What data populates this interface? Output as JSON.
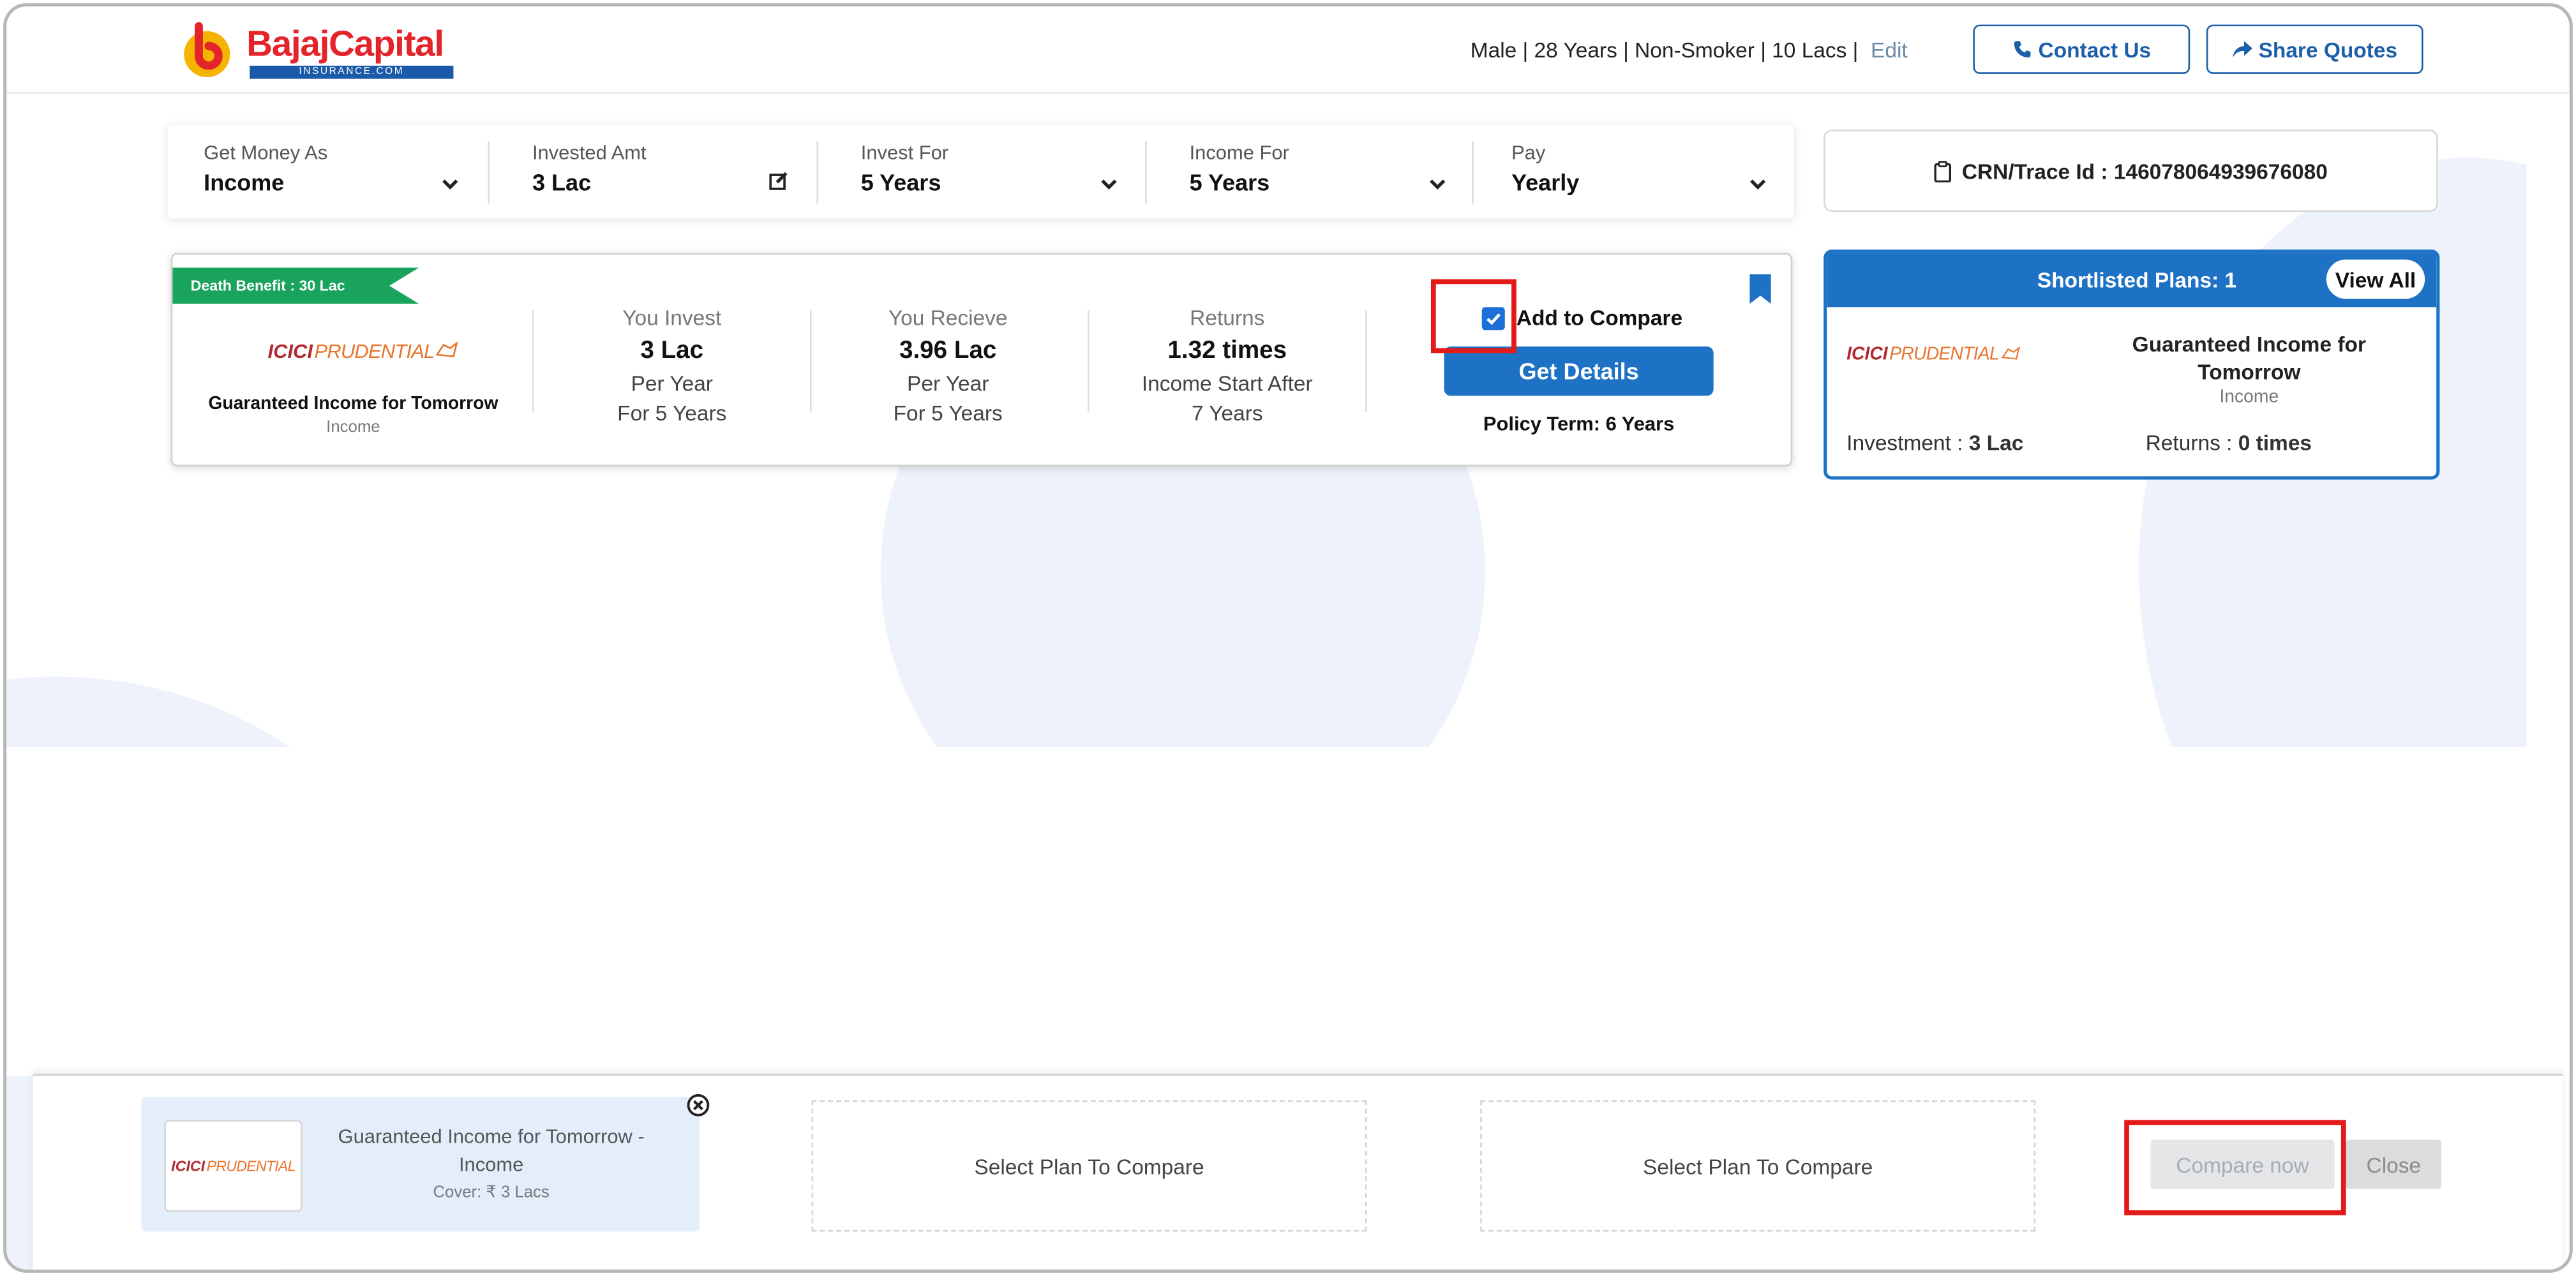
{
  "header": {
    "brand": "BajajCapital",
    "brand_sub": "INSURANCE.COM",
    "profile": "Male |  28 Years |  Non-Smoker |  10 Lacs |",
    "edit_label": "Edit",
    "contact_label": "Contact Us",
    "share_label": "Share Quotes"
  },
  "filters": [
    {
      "label": "Get Money As",
      "value": "Income"
    },
    {
      "label": "Invested Amt",
      "value": "3 Lac"
    },
    {
      "label": "Invest For",
      "value": "5 Years"
    },
    {
      "label": "Income For",
      "value": "5 Years"
    },
    {
      "label": "Pay",
      "value": "Yearly"
    }
  ],
  "crn": "CRN/Trace Id : 146078064939676080",
  "plan": {
    "ribbon": "Death Benefit : 30 Lac",
    "insurer_a": "ICICI",
    "insurer_b": "PRUDENTIAL",
    "name": "Guaranteed Income for Tomorrow",
    "type": "Income",
    "invest": {
      "head": "You Invest",
      "value": "3 Lac",
      "line1": "Per Year",
      "line2": "For 5 Years"
    },
    "receive": {
      "head": "You Recieve",
      "value": "3.96 Lac",
      "line1": "Per Year",
      "line2": "For 5 Years"
    },
    "returns": {
      "head": "Returns",
      "value": "1.32 times",
      "line1": "Income Start After",
      "line2": "7 Years"
    },
    "compare_label": "Add to Compare",
    "details_label": "Get Details",
    "policy_term": "Policy Term: 6 Years"
  },
  "shortlist": {
    "title": "Shortlisted Plans: 1",
    "view_all": "View All",
    "plan_name_1": "Guaranteed Income for",
    "plan_name_2": "Tomorrow",
    "plan_type": "Income",
    "investment_label": "Investment : ",
    "investment_value": "3 Lac",
    "returns_label": "Returns : ",
    "returns_value": "0 times"
  },
  "compare": {
    "slot1_title_1": "Guaranteed Income for Tomorrow -",
    "slot1_title_2": "Income",
    "slot1_cover": "Cover: ₹ 3 Lacs",
    "empty_label": "Select Plan To Compare",
    "compare_now": "Compare now",
    "close": "Close"
  },
  "colors": {
    "brand_red": "#e3242b",
    "primary_blue": "#1e72c6",
    "ribbon_green": "#1aa35c",
    "highlight_red": "#e21a1a"
  }
}
